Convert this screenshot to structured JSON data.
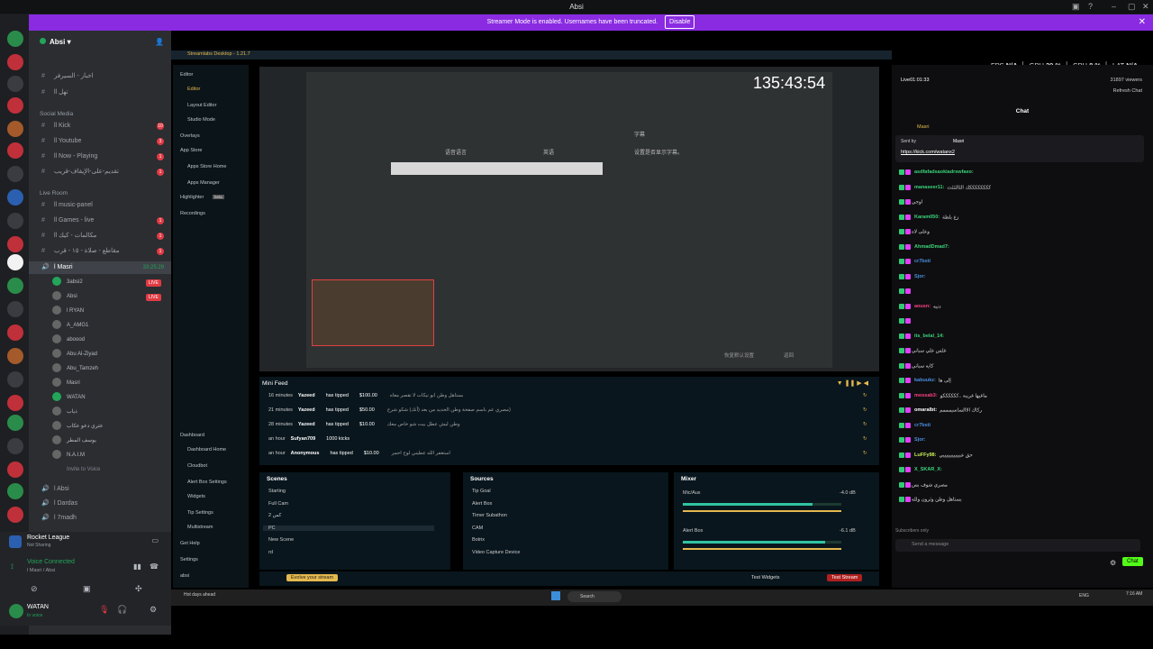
{
  "window": {
    "title": "Absi"
  },
  "banner": {
    "text": "Streamer Mode is enabled. Usernames have been truncated.",
    "action": "Disable"
  },
  "discord": {
    "server_name": "Absi",
    "channels_top": [
      {
        "name": "اخبار - السيرفر",
        "label": "ll"
      },
      {
        "name": "ll تهل"
      }
    ],
    "category_social": "Social Media",
    "social": [
      {
        "name": "ll Kick",
        "count": "10"
      },
      {
        "name": "ll Youtube",
        "count": "3"
      },
      {
        "name": "ll Now - Playing",
        "count": "1"
      },
      {
        "name": "تقديم-على-الإيقاف-قريب",
        "count": "1"
      }
    ],
    "category_live": "Live Room",
    "live": [
      {
        "name": "ll music-panel"
      },
      {
        "name": "ll Games - live",
        "count": "1"
      },
      {
        "name": "ll مكالمات - كيك",
        "count": "1"
      },
      {
        "name": "مقاطع - صلاة - ١٥ - قرب",
        "count": "1"
      }
    ],
    "voice_channel": {
      "name": "l Masri",
      "time": "33:25:29"
    },
    "voice_users": [
      {
        "name": "3absi2",
        "live": "LIVE"
      },
      {
        "name": "Absi",
        "live": "LIVE"
      },
      {
        "name": "l RYAN"
      },
      {
        "name": "A_AMG1"
      },
      {
        "name": "aboood"
      },
      {
        "name": "Abu Al-Ziyad"
      },
      {
        "name": "Abu_Tamzeh"
      },
      {
        "name": "Masri"
      },
      {
        "name": "WATAN"
      },
      {
        "name": "ذياب"
      },
      {
        "name": "عثري دعو عكاب"
      },
      {
        "name": "يوسف المطر"
      },
      {
        "name": "N.A.I.M"
      }
    ],
    "invite": "Invite to Voice",
    "other_voice": [
      {
        "name": "l Absi"
      },
      {
        "name": "l Dardas"
      },
      {
        "name": "l 7madh"
      }
    ],
    "activity": {
      "game": "Rocket League",
      "status": "Not Sharing"
    },
    "voice": {
      "status": "Voice Connected",
      "channel": "l Masri / Absi"
    },
    "user": {
      "name": "WATAN",
      "status": "In voice"
    }
  },
  "streamlabs": {
    "title": "Streamlabs Desktop - 1.21.7",
    "sidebar": [
      {
        "label": "Editor",
        "type": "head"
      },
      {
        "label": "Editor",
        "type": "sub"
      },
      {
        "label": "Layout Editor",
        "type": "sub"
      },
      {
        "label": "Studio Mode",
        "type": "sub"
      },
      {
        "label": "Overlays",
        "type": "head"
      },
      {
        "label": "App Store",
        "type": "head"
      },
      {
        "label": "Apps Store Home",
        "type": "sub"
      },
      {
        "label": "Apps Manager",
        "type": "sub"
      },
      {
        "label": "Highlighter",
        "type": "head"
      },
      {
        "label": "Recordings",
        "type": "head"
      }
    ],
    "highlighter_badge": "beta",
    "sidebar2": [
      {
        "label": "Dashboard",
        "type": "head"
      },
      {
        "label": "Dashboard Home",
        "type": "sub"
      },
      {
        "label": "Cloudbot",
        "type": "sub"
      },
      {
        "label": "Alert Box Settings",
        "type": "sub"
      },
      {
        "label": "Widgets",
        "type": "sub"
      },
      {
        "label": "Tip Settings",
        "type": "sub"
      },
      {
        "label": "Multistream",
        "type": "sub"
      },
      {
        "label": "Get Help",
        "type": "head"
      },
      {
        "label": "Settings",
        "type": "head"
      },
      {
        "label": "absi",
        "type": "head"
      }
    ],
    "timer": "135:43:54",
    "game_text": {
      "left": "语音语言",
      "right": "字幕",
      "hint": "设置是否显示字幕。",
      "mid": "英语",
      "bottom_left": "恢复默认设置",
      "bottom_right": "返回"
    },
    "minifeed": {
      "title": "Mini Feed",
      "items": [
        {
          "time": "16 minutes",
          "user": "Yazeed",
          "action": "has tipped",
          "amount": "$100.00",
          "msg": "بستاهل وطن ابو نيكات لا تقصر معاه"
        },
        {
          "time": "21 minutes",
          "user": "Yazeed",
          "action": "has tipped",
          "amount": "$50.00",
          "msg": "مصري عم باسم صفحة وطن الحديد من بعد (أنك) شكو شرح)"
        },
        {
          "time": "28 minutes",
          "user": "Yazeed",
          "action": "has tipped",
          "amount": "$10.00",
          "msg": "وطن ليش عطل بيت شو خاص معك"
        },
        {
          "time": "an hour",
          "user": "Sufyan709",
          "action": "1000 kicks",
          "amount": "",
          "msg": ""
        },
        {
          "time": "an hour",
          "user": "Anonymous",
          "action": "has tipped",
          "amount": "$10.00",
          "msg": "استغفر الله عطيني لوح احمر"
        }
      ]
    },
    "scenes": {
      "title": "Scenes",
      "items": [
        "Starting",
        "Full Cam",
        "2 كس",
        "PC",
        "New Scene",
        "rd"
      ],
      "selected": 3
    },
    "sources": {
      "title": "Sources",
      "items": [
        "Tip Goal",
        "Alert Box",
        "Timer Subathon",
        "CAM",
        "Botrix",
        "Video Capture Device"
      ]
    },
    "mixer": {
      "title": "Mixer",
      "channels": [
        {
          "name": "Mic/Aux",
          "db": "-4.0 dB",
          "level": 0.82
        },
        {
          "name": "Alert Box",
          "db": "-6.1 dB",
          "level": 0.9
        }
      ]
    },
    "bottom": {
      "promo": "Evolve your stream",
      "widgets": "Test Widgets",
      "golive": "Test Stream"
    }
  },
  "stats": {
    "fps_label": "FPS",
    "fps": "N/A",
    "gpu_label": "GPU",
    "gpu": "29 %",
    "cpu_label": "CPU",
    "cpu": "8 %",
    "lat_label": "LAT",
    "lat": "N/A"
  },
  "chat": {
    "live_time": "Live01:01:33",
    "viewers": "31897 viewers",
    "refresh": "Refresh Chat",
    "title": "Chat",
    "pinned_by": "Sent by",
    "pinned_user": "Masri",
    "pinned_link": "https://kick.com/watanx2",
    "top_user": "Masri",
    "messages": [
      {
        "user": "asdfafadsaokiadrswfaeo:",
        "text": "",
        "color": "#3cd37b"
      },
      {
        "user": "manaseer11:",
        "text": "ككككككككك الثالثثثث",
        "color": "#3cd37b"
      },
      {
        "user": "",
        "text": "اوجي",
        "color": "#ff4081"
      },
      {
        "user": "Karam050:",
        "text": "زع بلطة",
        "color": "#3cd37b"
      },
      {
        "user": "",
        "text": "وعلى لاه",
        "color": "#ff4081"
      },
      {
        "user": "AhmadDmad7:",
        "text": "",
        "color": "#3cd37b"
      },
      {
        "user": "cr7bsti",
        "text": "",
        "color": "#4a90e2"
      },
      {
        "user": "Sjor:",
        "text": "",
        "color": "#4a90e2"
      },
      {
        "user": "",
        "text": "",
        "color": "#ff4081"
      },
      {
        "user": "aousn:",
        "text": "دنيه",
        "color": "#ff4081"
      },
      {
        "user": "",
        "text": "",
        "color": "#ff4081"
      },
      {
        "user": "its_belal_14:",
        "text": "",
        "color": "#3cd37b"
      },
      {
        "user": "",
        "text": "غلس علي سباني",
        "color": "#ff4081"
      },
      {
        "user": "",
        "text": "كايه سباني",
        "color": "#ff4081"
      },
      {
        "user": "kabuukz:",
        "text": "إلى ها",
        "color": "#4a90e2"
      },
      {
        "user": "mossab3:",
        "text": "ماغيها غريبه ..ككككككو",
        "color": "#ff4081"
      },
      {
        "user": "omaralbt:",
        "text": "ركاك الاالساسيمممم",
        "color": "#ffffff"
      },
      {
        "user": "cr7bsti",
        "text": "",
        "color": "#4a90e2"
      },
      {
        "user": "Sjor:",
        "text": "",
        "color": "#4a90e2"
      },
      {
        "user": "LuFFy98:",
        "text": "حق عبيييييييييييي",
        "color": "#c9f05a"
      },
      {
        "user": "X_SKAR_X:",
        "text": "",
        "color": "#3cd37b"
      },
      {
        "user": "",
        "text": "مصري شوف بس",
        "color": "#ff4081"
      },
      {
        "user": "",
        "text": "بستاهل وطن وثرون ولله",
        "color": "#ff4081"
      }
    ],
    "subscribers_only": "Subscribers only",
    "input_placeholder": "Send a message",
    "send": "Chat"
  },
  "taskbar": {
    "weather": "Hot days ahead",
    "search": "Search",
    "time": "7:16 AM",
    "lang": "ENG"
  },
  "colors": {
    "accent": "#8a2be2",
    "kick_green": "#53fc18",
    "live_red": "#e03b44"
  }
}
